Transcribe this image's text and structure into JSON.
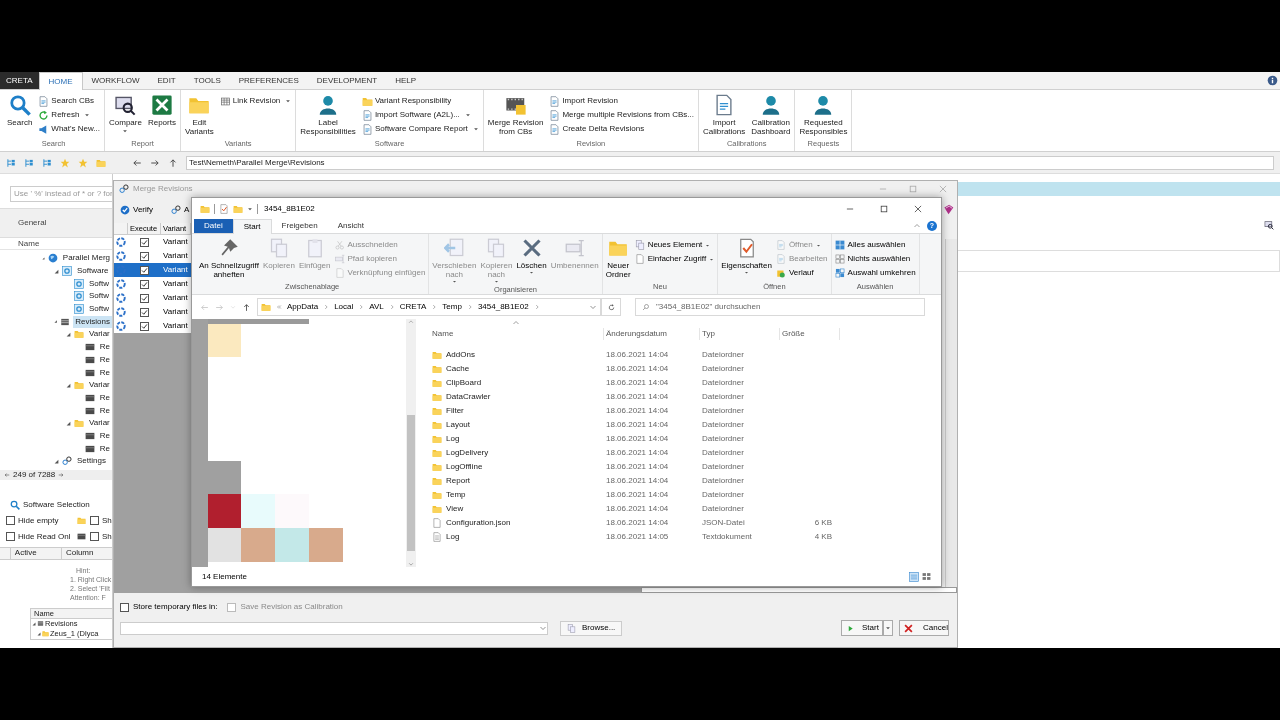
{
  "app": {
    "title": "CRETA",
    "tabs": [
      {
        "label": "HOME",
        "selected": true
      },
      {
        "label": "WORKFLOW",
        "selected": false
      },
      {
        "label": "EDIT",
        "selected": false
      },
      {
        "label": "TOOLS",
        "selected": false
      },
      {
        "label": "PREFERENCES",
        "selected": false
      },
      {
        "label": "DEVELOPMENT",
        "selected": false
      },
      {
        "label": "HELP",
        "selected": false
      }
    ],
    "ribbon": [
      {
        "label": "Search",
        "items": [
          {
            "kind": "large",
            "label": "Search",
            "dropdown": false
          },
          {
            "kind": "small",
            "label": "Search CBs",
            "dropdown": false
          },
          {
            "kind": "small",
            "label": "Refresh",
            "dropdown": true
          },
          {
            "kind": "small",
            "label": "What's New...",
            "dropdown": false
          }
        ]
      },
      {
        "label": "Report",
        "items": [
          {
            "kind": "large",
            "label": "Compare",
            "dropdown": true
          },
          {
            "kind": "large",
            "label": "Reports",
            "dropdown": false
          }
        ]
      },
      {
        "label": "Variants",
        "items": [
          {
            "kind": "large",
            "label": "Edit\nVariants",
            "dropdown": false
          },
          {
            "kind": "small",
            "label": "Link Revision",
            "dropdown": true
          }
        ]
      },
      {
        "label": "Software",
        "items": [
          {
            "kind": "large",
            "label": "Label\nResponsibilities",
            "dropdown": false
          },
          {
            "kind": "small",
            "label": "Variant Responsibility",
            "dropdown": false
          },
          {
            "kind": "small",
            "label": "Import Software (A2L)...",
            "dropdown": true
          },
          {
            "kind": "small",
            "label": "Software Compare Report",
            "dropdown": true
          }
        ]
      },
      {
        "label": "Revision",
        "items": [
          {
            "kind": "large",
            "label": "Merge Revision\nfrom CBs",
            "dropdown": false
          },
          {
            "kind": "small",
            "label": "Import Revision",
            "dropdown": false
          },
          {
            "kind": "small",
            "label": "Merge multiple Revisions from CBs...",
            "dropdown": false
          },
          {
            "kind": "small",
            "label": "Create Delta Revisions",
            "dropdown": false
          }
        ]
      },
      {
        "label": "Calibrations",
        "items": [
          {
            "kind": "large",
            "label": "Import\nCalibrations",
            "dropdown": false
          },
          {
            "kind": "large",
            "label": "Calibration\nDashboard",
            "dropdown": false
          }
        ]
      },
      {
        "label": "Requests",
        "items": [
          {
            "kind": "large",
            "label": "Requested\nResponsibles",
            "dropdown": false
          }
        ]
      }
    ],
    "path": "Test\\Nemeth\\Parallel Merge\\Revisions",
    "search_placeholder": "Use ' %' instead of * or ? for",
    "general_header": "General",
    "name_header": "Name",
    "tree": [
      {
        "label": "Parallel Merg",
        "kind": "project",
        "expanded": true,
        "selected": false,
        "children": [
          {
            "label": "Software",
            "kind": "software",
            "expanded": true,
            "selected": false,
            "children": [
              {
                "label": "Softw",
                "kind": "software_item",
                "selected": false
              },
              {
                "label": "Softw",
                "kind": "software_item",
                "selected": false
              },
              {
                "label": "Softw",
                "kind": "software_item",
                "selected": false
              }
            ]
          },
          {
            "label": "Revisions",
            "kind": "revisions",
            "expanded": true,
            "selected": true,
            "children": [
              {
                "label": "Variar",
                "kind": "variant",
                "expanded": true,
                "selected": false,
                "children": [
                  {
                    "label": "Re",
                    "kind": "revision",
                    "selected": false
                  },
                  {
                    "label": "Re",
                    "kind": "revision",
                    "selected": false
                  },
                  {
                    "label": "Re",
                    "kind": "revision",
                    "selected": false
                  }
                ]
              },
              {
                "label": "Variar",
                "kind": "variant",
                "expanded": true,
                "selected": false,
                "children": [
                  {
                    "label": "Re",
                    "kind": "revision",
                    "selected": false
                  },
                  {
                    "label": "Re",
                    "kind": "revision",
                    "selected": false
                  }
                ]
              },
              {
                "label": "Variar",
                "kind": "variant",
                "expanded": true,
                "selected": false,
                "children": [
                  {
                    "label": "Re",
                    "kind": "revision",
                    "selected": false
                  },
                  {
                    "label": "Re",
                    "kind": "revision",
                    "selected": false
                  }
                ]
              }
            ]
          },
          {
            "label": "Settings",
            "kind": "settings",
            "expanded": true,
            "selected": false
          }
        ]
      }
    ],
    "count": "249 of 7288",
    "selection_title": "Software Selection",
    "options": [
      {
        "label": "Hide empty",
        "checked": false
      },
      {
        "label": "Sh",
        "checked": false
      },
      {
        "label": "Hide Read Onl",
        "checked": false
      },
      {
        "label": "Sh",
        "checked": false
      }
    ],
    "filter_columns": [
      "Active",
      "Column"
    ],
    "hint": [
      "Hint:",
      "1. Right Click",
      "2. Select 'Filt",
      "Attention: F"
    ],
    "mini_tree": {
      "header": "Name",
      "items": [
        {
          "label": "Revisions",
          "kind": "revisions",
          "expanded": true,
          "children": [
            {
              "label": "Zeus_1 (Dlyca",
              "kind": "variant",
              "expanded": true
            }
          ]
        }
      ]
    }
  },
  "merge_dialog": {
    "title": "Merge Revisions",
    "toolbar": [
      "Verify",
      "A"
    ],
    "columns": [
      "Execute",
      "Variant"
    ],
    "rows": [
      {
        "checked": true,
        "variant": "Variant",
        "selected": false
      },
      {
        "checked": true,
        "variant": "Variant",
        "selected": false
      },
      {
        "checked": true,
        "variant": "Variant",
        "selected": true
      },
      {
        "checked": true,
        "variant": "Variant",
        "selected": false
      },
      {
        "checked": true,
        "variant": "Variant",
        "selected": false
      },
      {
        "checked": true,
        "variant": "Variant",
        "selected": false
      },
      {
        "checked": true,
        "variant": "Variant",
        "selected": false
      }
    ],
    "store_temp": {
      "label": "Store temporary files in:",
      "checked": false
    },
    "save_calibration": {
      "label": "Save Revision as Calibration",
      "checked": false,
      "disabled": true
    },
    "browse": "Browse...",
    "start": "Start",
    "cancel": "Cancel"
  },
  "explorer": {
    "title": "3454_8B1E02",
    "tabs": [
      {
        "label": "Datei",
        "kind": "file",
        "selected": false
      },
      {
        "label": "Start",
        "kind": "tab",
        "selected": true
      },
      {
        "label": "Freigeben",
        "kind": "tab",
        "selected": false
      },
      {
        "label": "Ansicht",
        "kind": "tab",
        "selected": false
      }
    ],
    "help": "?",
    "ribbon": [
      {
        "label": "Zwischenablage",
        "items": [
          {
            "kind": "large",
            "label": "An Schnellzugriff\nanheften",
            "disabled": false,
            "dropdown": false
          },
          {
            "kind": "large",
            "label": "Kopieren",
            "disabled": true,
            "dropdown": false
          },
          {
            "kind": "large",
            "label": "Einfügen",
            "disabled": true,
            "dropdown": false
          },
          {
            "kind": "small",
            "label": "Ausschneiden",
            "disabled": true,
            "dropdown": false
          },
          {
            "kind": "small",
            "label": "Pfad kopieren",
            "disabled": true,
            "dropdown": false
          },
          {
            "kind": "small",
            "label": "Verknüpfung einfügen",
            "disabled": true,
            "dropdown": false
          }
        ]
      },
      {
        "label": "Organisieren",
        "items": [
          {
            "kind": "large",
            "label": "Verschieben\nnach",
            "disabled": true,
            "dropdown": true
          },
          {
            "kind": "large",
            "label": "Kopieren\nnach",
            "disabled": true,
            "dropdown": true
          },
          {
            "kind": "large",
            "label": "Löschen",
            "disabled": false,
            "dropdown": true
          },
          {
            "kind": "large",
            "label": "Umbenennen",
            "disabled": true,
            "dropdown": false
          }
        ]
      },
      {
        "label": "Neu",
        "items": [
          {
            "kind": "large",
            "label": "Neuer\nOrdner",
            "disabled": false,
            "dropdown": false
          },
          {
            "kind": "small",
            "label": "Neues Element",
            "disabled": false,
            "dropdown": true
          },
          {
            "kind": "small",
            "label": "Einfacher Zugriff",
            "disabled": false,
            "dropdown": true
          }
        ]
      },
      {
        "label": "Öffnen",
        "items": [
          {
            "kind": "large",
            "label": "Eigenschaften",
            "disabled": false,
            "dropdown": true
          },
          {
            "kind": "small",
            "label": "Öffnen",
            "disabled": true,
            "dropdown": true
          },
          {
            "kind": "small",
            "label": "Bearbeiten",
            "disabled": true,
            "dropdown": false
          },
          {
            "kind": "small",
            "label": "Verlauf",
            "disabled": false,
            "dropdown": false
          }
        ]
      },
      {
        "label": "Auswählen",
        "items": [
          {
            "kind": "small",
            "label": "Alles auswählen",
            "disabled": false,
            "dropdown": false
          },
          {
            "kind": "small",
            "label": "Nichts auswählen",
            "disabled": false,
            "dropdown": false
          },
          {
            "kind": "small",
            "label": "Auswahl umkehren",
            "disabled": false,
            "dropdown": false
          }
        ]
      }
    ],
    "address": [
      "AppData",
      "Local",
      "AVL",
      "CRETA",
      "Temp",
      "3454_8B1E02"
    ],
    "search_placeholder": "\"3454_8B1E02\" durchsuchen",
    "columns": [
      "Name",
      "Änderungsdatum",
      "Typ",
      "Größe"
    ],
    "files": [
      {
        "kind": "folder",
        "name": "AddOns",
        "date": "18.06.2021 14:04",
        "type": "Dateiordner"
      },
      {
        "kind": "folder",
        "name": "Cache",
        "date": "18.06.2021 14:04",
        "type": "Dateiordner"
      },
      {
        "kind": "folder",
        "name": "ClipBoard",
        "date": "18.06.2021 14:04",
        "type": "Dateiordner"
      },
      {
        "kind": "folder",
        "name": "DataCrawler",
        "date": "18.06.2021 14:04",
        "type": "Dateiordner"
      },
      {
        "kind": "folder",
        "name": "Filter",
        "date": "18.06.2021 14:04",
        "type": "Dateiordner"
      },
      {
        "kind": "folder",
        "name": "Layout",
        "date": "18.06.2021 14:04",
        "type": "Dateiordner"
      },
      {
        "kind": "folder",
        "name": "Log",
        "date": "18.06.2021 14:04",
        "type": "Dateiordner"
      },
      {
        "kind": "folder",
        "name": "LogDelivery",
        "date": "18.06.2021 14:04",
        "type": "Dateiordner"
      },
      {
        "kind": "folder",
        "name": "LogOffline",
        "date": "18.06.2021 14:04",
        "type": "Dateiordner"
      },
      {
        "kind": "folder",
        "name": "Report",
        "date": "18.06.2021 14:04",
        "type": "Dateiordner"
      },
      {
        "kind": "folder",
        "name": "Temp",
        "date": "18.06.2021 14:04",
        "type": "Dateiordner"
      },
      {
        "kind": "folder",
        "name": "View",
        "date": "18.06.2021 14:04",
        "type": "Dateiordner"
      },
      {
        "kind": "file",
        "name": "Configuration.json",
        "date": "18.06.2021 14:04",
        "type": "JSON-Datei",
        "size": "6 KB"
      },
      {
        "kind": "text",
        "name": "Log",
        "date": "18.06.2021 14:05",
        "type": "Textdokument",
        "size": "4 KB"
      }
    ],
    "status": "14 Elemente"
  }
}
